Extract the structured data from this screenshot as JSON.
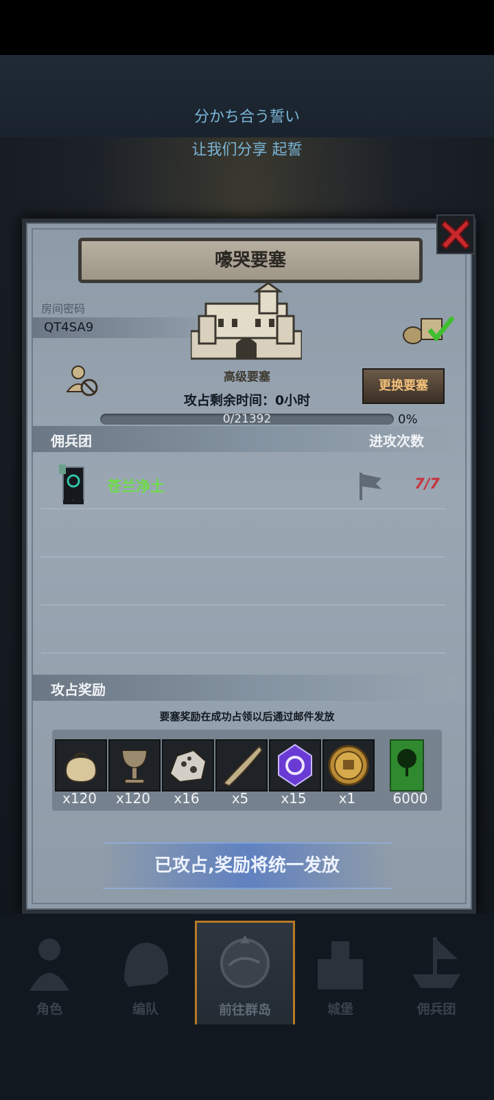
{
  "header": {
    "line1": "分かち合う誓い",
    "line2": "让我们分享 起誓"
  },
  "dialog": {
    "title": "嚎哭要塞",
    "room_label": "房间密码",
    "room_code": "QT4SA9",
    "castle_name": "高级要塞",
    "change_button": "更换要塞",
    "timer_text": "攻占剩余时间：0小时",
    "progress": {
      "current": 0,
      "total": 21392,
      "text": "0/21392",
      "percent_label": "0%",
      "fraction": 0.0
    },
    "columns": {
      "guild": "佣兵团",
      "attacks": "进攻次数"
    },
    "guild_rows": [
      {
        "name": "苍兰净土",
        "attacks": "7/7"
      }
    ],
    "rewards_title": "攻占奖励",
    "rewards_note": "要塞奖励在成功占领以后通过邮件发放",
    "rewards": [
      {
        "icon": "sack-icon",
        "qty": "x120"
      },
      {
        "icon": "goblet-icon",
        "qty": "x120"
      },
      {
        "icon": "ore-icon",
        "qty": "x16"
      },
      {
        "icon": "horn-icon",
        "qty": "x5"
      },
      {
        "icon": "purple-gem-icon",
        "qty": "x15"
      },
      {
        "icon": "gold-medal-icon",
        "qty": "x1"
      },
      {
        "icon": "tree-banner-icon",
        "qty": "6000"
      }
    ],
    "action_text": "已攻占,奖励将统一发放"
  },
  "bottom_nav": [
    {
      "label": "角色",
      "icon": "knight-icon"
    },
    {
      "label": "编队",
      "icon": "helmet-icon"
    },
    {
      "label": "前往群岛",
      "icon": "compass-map-icon",
      "active": true
    },
    {
      "label": "城堡",
      "icon": "castle-icon"
    },
    {
      "label": "佣兵团",
      "icon": "ship-icon"
    }
  ],
  "colors": {
    "guild_name": "#6fdc4a",
    "attack_count": "#c8323a",
    "change_button_text": "#f2c07c",
    "active_nav_border": "#b87a26"
  }
}
